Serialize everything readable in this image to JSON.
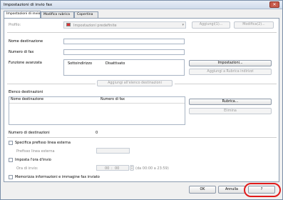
{
  "window": {
    "title": "Impostazioni di invio fax",
    "close_glyph": "✕"
  },
  "tabs": [
    {
      "label": "Impostazioni di invio"
    },
    {
      "label": "Modifica rubrica"
    },
    {
      "label": "Copertina"
    }
  ],
  "profile": {
    "label": "Profilo:",
    "value": "Impostazioni predefinite",
    "add_label": "Aggiungi(1)...",
    "edit_label": "Modifica(2)..."
  },
  "fields": {
    "dest_name_label": "Nome destinazione",
    "dest_name_value": "",
    "fax_number_label": "Numero di fax",
    "fax_number_value": "",
    "advanced_label": "Funzione avanzata",
    "subaddress_label": "Sottoindirizzo",
    "subaddress_value": "Disattivato",
    "settings_button": "Impostazioni...",
    "add_to_book_button": "Aggiungi a Rubrica indirizzi",
    "add_to_list_button": "Aggiungi all'elenco destinazioni"
  },
  "dest_list": {
    "label": "Elenco destinazioni",
    "col_name": "Nome destinazione",
    "col_fax": "Numero di fax",
    "rubrica_button": "Rubrica...",
    "delete_button": "Elimina"
  },
  "dest_count": {
    "label": "Numero di destinazioni",
    "value": "0"
  },
  "prefix": {
    "checkbox_label": "Specifica prefisso linea esterna",
    "sub_label": "Prefisso linea esterna"
  },
  "schedule": {
    "checkbox_label": "Imposta l'ora d'invio",
    "time_label": "Ora di invio:",
    "hour": "00",
    "minute": "00",
    "range": "(da 00:00 a 23:59)"
  },
  "store": {
    "checkbox_label": "Memorizza informazioni e immagine fax inviato"
  },
  "footer": {
    "ok": "OK",
    "cancel": "Annulla",
    "help": "?"
  }
}
